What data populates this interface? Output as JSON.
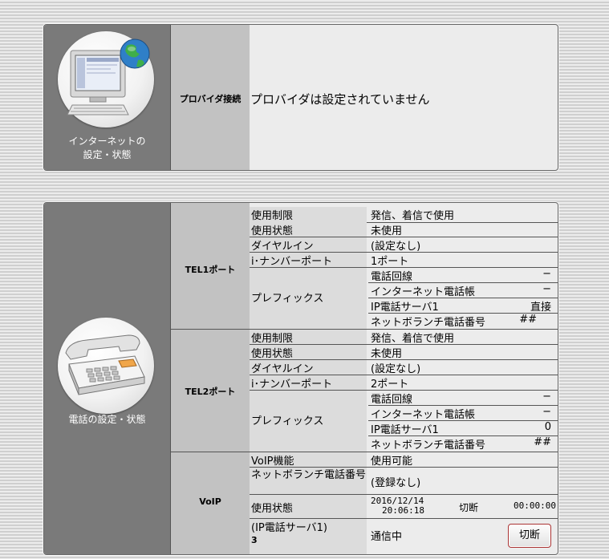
{
  "internet": {
    "caption_line1": "インターネットの",
    "caption_line2": "設定・状態",
    "provider_label": "プロバイダ接続",
    "provider_value": "プロバイダは設定されていません"
  },
  "phone": {
    "caption": "電話の設定・状態",
    "tel1": {
      "label": "TEL1ポート",
      "usage_limit_key": "使用制限",
      "usage_limit_val": "発信、着信で使用",
      "usage_state_key": "使用状態",
      "usage_state_val": "未使用",
      "dial_in_key": "ダイヤルイン",
      "dial_in_val": "(設定なし)",
      "inumber_key": "i･ナンバーポート",
      "inumber_val": "1ポート",
      "prefix_key": "プレフィックス",
      "prefix_rows": [
        {
          "k": "電話回線",
          "v": "−"
        },
        {
          "k": "インターネット電話帳",
          "v": "−"
        },
        {
          "k": "IP電話サーバ1",
          "v": "直接"
        },
        {
          "k": "ネットボランチ電話番号",
          "v": "##"
        }
      ]
    },
    "tel2": {
      "label": "TEL2ポート",
      "usage_limit_key": "使用制限",
      "usage_limit_val": "発信、着信で使用",
      "usage_state_key": "使用状態",
      "usage_state_val": "未使用",
      "dial_in_key": "ダイヤルイン",
      "dial_in_val": "(設定なし)",
      "inumber_key": "i･ナンバーポート",
      "inumber_val": "2ポート",
      "prefix_key": "プレフィックス",
      "prefix_rows": [
        {
          "k": "電話回線",
          "v": "−"
        },
        {
          "k": "インターネット電話帳",
          "v": "−"
        },
        {
          "k": "IP電話サーバ1",
          "v": "0"
        },
        {
          "k": "ネットボランチ電話番号",
          "v": "##"
        }
      ]
    },
    "voip": {
      "label": "VoIP",
      "function_key": "VoIP機能",
      "function_val": "使用可能",
      "netvolante_key": "ネットボランチ電話番号",
      "netvolante_val": "(登録なし)",
      "state_key": "使用状態",
      "state_date": "2016/12/14",
      "state_time": "20:06:18",
      "state_status": "切断",
      "state_duration": "00:00:00",
      "server_key_line1": "(IP電話サーバ1)",
      "server_key_line2": "3",
      "server_val": "通信中",
      "cut_button": "切断"
    }
  }
}
